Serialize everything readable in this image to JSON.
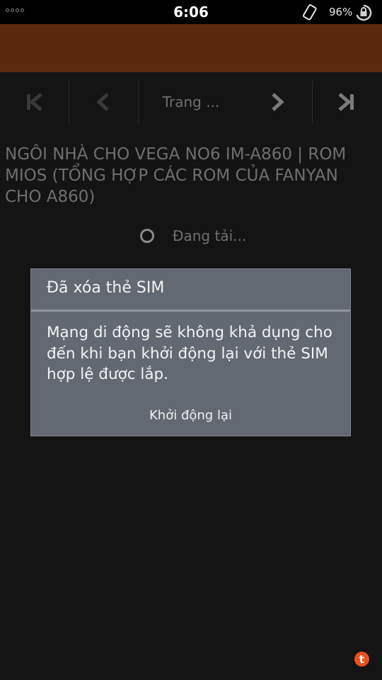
{
  "status_bar": {
    "time": "6:06",
    "battery": "96%"
  },
  "nav": {
    "page_label": "Trang ..."
  },
  "thread": {
    "title": "NGÔI NHÀ CHO VEGA NO6 IM-A860 | ROM MIOS (TỔNG HỢP CÁC ROM CỦA FANYAN CHO A860)"
  },
  "loading": {
    "text": "Đang tải..."
  },
  "dialog": {
    "title": "Đã xóa thẻ SIM",
    "message": "Mạng di động sẽ không khả dụng cho đến khi bạn khởi động lại với thẻ SIM hợp lệ được lắp.",
    "button_label": "Khởi động lại"
  },
  "fab": {
    "glyph": "t"
  },
  "colors": {
    "header": "#5b2a0e",
    "background": "#141414",
    "dialog": "#636973",
    "fab": "#e8501c"
  }
}
